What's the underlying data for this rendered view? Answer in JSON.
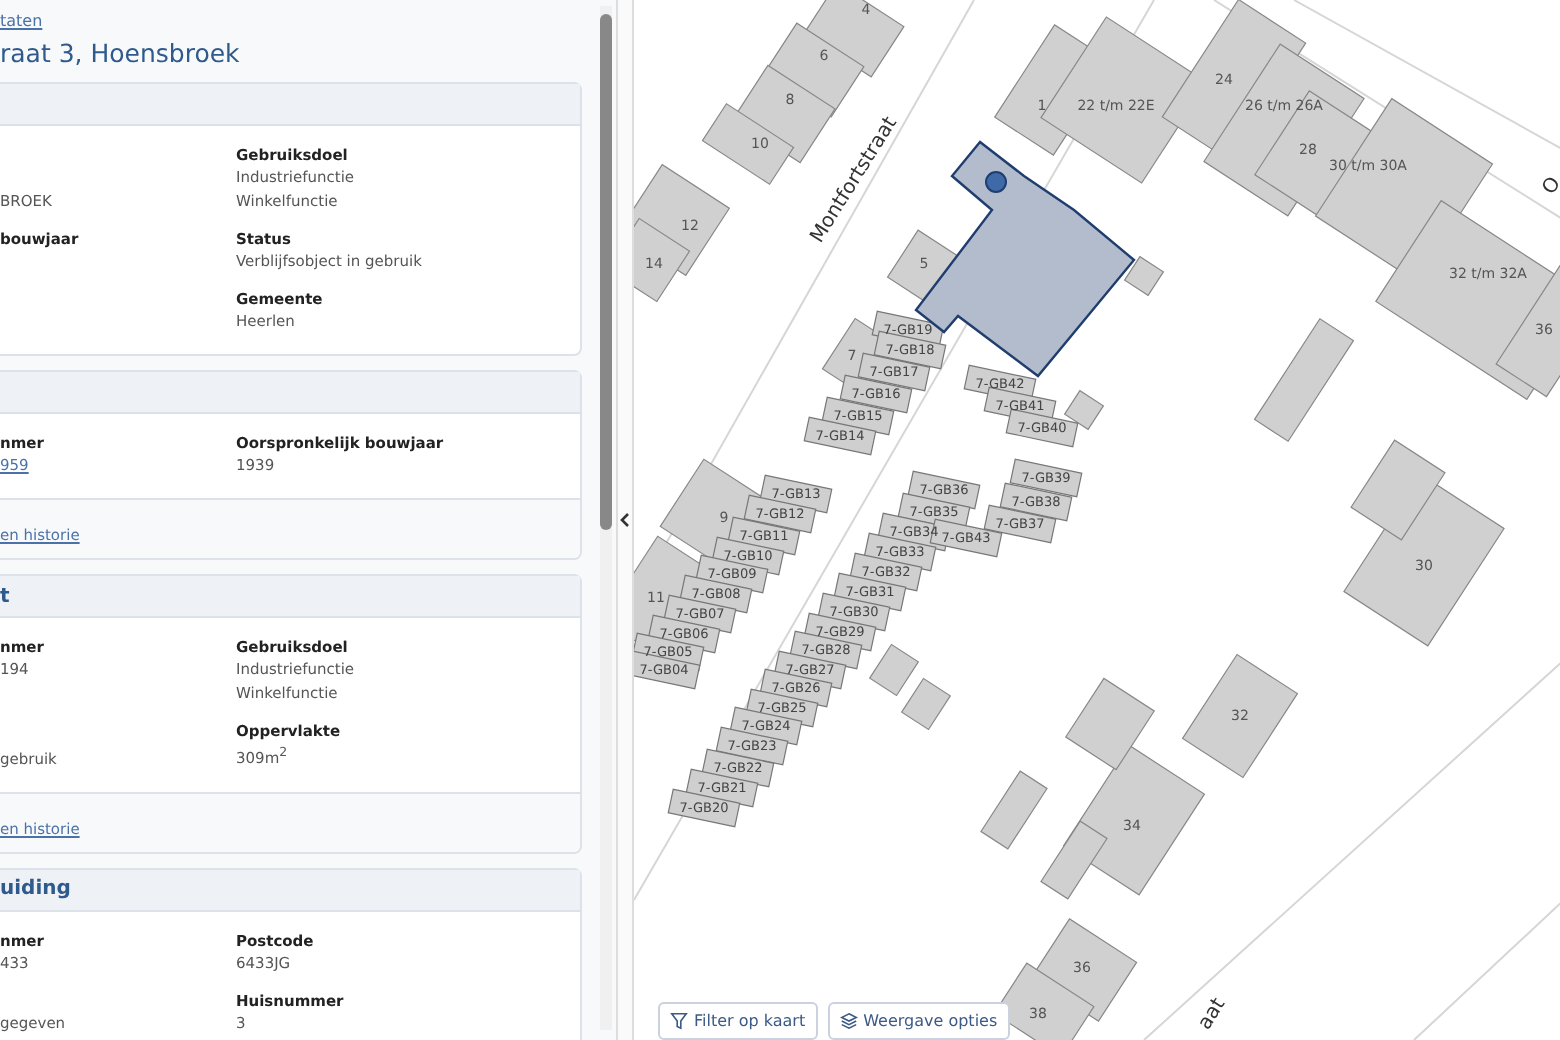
{
  "panel": {
    "breadcrumb": "taten",
    "title": "raat 3, Hoensbroek",
    "cards": [
      {
        "rows": [
          {
            "left": {
              "values": [
                "BROEK"
              ],
              "link": false
            },
            "right": {
              "label": "Gebruiksdoel",
              "values": [
                "Industriefunctie",
                "Winkelfunctie"
              ],
              "link": false
            }
          },
          {
            "left": {
              "label": "bouwjaar"
            },
            "right": {
              "label": "Status",
              "values": [
                "Verblijfsobject in gebruik"
              ],
              "link": false
            }
          },
          {
            "right": {
              "label": "Gemeente",
              "values": [
                "Heerlen"
              ],
              "link": false
            }
          }
        ]
      },
      {
        "rows": [
          {
            "left": {
              "label": "nmer",
              "values": [
                "959"
              ],
              "link": true
            },
            "right": {
              "label": "Oorspronkelijk bouwjaar",
              "values": [
                "1939"
              ],
              "link": false
            }
          }
        ],
        "footer_link": "en historie"
      },
      {
        "header": "t",
        "rows": [
          {
            "left": {
              "label": "nmer",
              "values": [
                "194"
              ],
              "link": false
            },
            "right": {
              "label": "Gebruiksdoel",
              "values": [
                "Industriefunctie",
                "Winkelfunctie"
              ],
              "link": false
            }
          },
          {
            "left": {
              "values": [
                "gebruik"
              ],
              "link": false
            },
            "right": {
              "label": "Oppervlakte",
              "values": [
                "309m$^{2}$"
              ],
              "link": false
            }
          }
        ],
        "footer_link": "en historie"
      },
      {
        "header": "uiding",
        "rows": [
          {
            "left": {
              "label": "nmer",
              "values": [
                "433"
              ],
              "link": false
            },
            "right": {
              "label": "Postcode",
              "values": [
                "6433JG"
              ],
              "link": false
            }
          },
          {
            "left": {
              "values": [
                "gegeven"
              ],
              "link": false
            },
            "right": {
              "label": "Huisnummer",
              "values": [
                "3"
              ],
              "link": false
            }
          }
        ]
      }
    ]
  },
  "map": {
    "labels": [
      {
        "text": "4",
        "kind": "building"
      },
      {
        "text": "6",
        "kind": "building"
      },
      {
        "text": "8",
        "kind": "building"
      },
      {
        "text": "10",
        "kind": "building"
      },
      {
        "text": "12",
        "kind": "building"
      },
      {
        "text": "14",
        "kind": "building"
      },
      {
        "text": "1",
        "kind": "building"
      },
      {
        "text": "22 t/m 22E",
        "kind": "building"
      },
      {
        "text": "24",
        "kind": "building"
      },
      {
        "text": "26 t/m 26A",
        "kind": "building"
      },
      {
        "text": "28",
        "kind": "building"
      },
      {
        "text": "30 t/m 30A",
        "kind": "building"
      },
      {
        "text": "32 t/m 32A",
        "kind": "building"
      },
      {
        "text": "36",
        "kind": "building"
      },
      {
        "text": "Montfortstraat",
        "kind": "street"
      },
      {
        "text": "O",
        "kind": "street"
      },
      {
        "text": "5",
        "kind": "building"
      },
      {
        "text": "7",
        "kind": "building"
      },
      {
        "text": "9",
        "kind": "building"
      },
      {
        "text": "11",
        "kind": "building"
      },
      {
        "text": "30",
        "kind": "building"
      },
      {
        "text": "32",
        "kind": "building"
      },
      {
        "text": "34",
        "kind": "building"
      },
      {
        "text": "36",
        "kind": "building"
      },
      {
        "text": "38",
        "kind": "building"
      },
      {
        "text": "aat",
        "kind": "street"
      },
      {
        "text": "7-GB19",
        "kind": "unit"
      },
      {
        "text": "7-GB18",
        "kind": "unit"
      },
      {
        "text": "7-GB17",
        "kind": "unit"
      },
      {
        "text": "7-GB16",
        "kind": "unit"
      },
      {
        "text": "7-GB15",
        "kind": "unit"
      },
      {
        "text": "7-GB14",
        "kind": "unit"
      },
      {
        "text": "7-GB42",
        "kind": "unit"
      },
      {
        "text": "7-GB41",
        "kind": "unit"
      },
      {
        "text": "7-GB40",
        "kind": "unit"
      },
      {
        "text": "7-GB39",
        "kind": "unit"
      },
      {
        "text": "7-GB38",
        "kind": "unit"
      },
      {
        "text": "7-GB37",
        "kind": "unit"
      },
      {
        "text": "7-GB36",
        "kind": "unit"
      },
      {
        "text": "7-GB35",
        "kind": "unit"
      },
      {
        "text": "7-GB34",
        "kind": "unit"
      },
      {
        "text": "7-GB43",
        "kind": "unit"
      },
      {
        "text": "7-GB33",
        "kind": "unit"
      },
      {
        "text": "7-GB32",
        "kind": "unit"
      },
      {
        "text": "7-GB31",
        "kind": "unit"
      },
      {
        "text": "7-GB30",
        "kind": "unit"
      },
      {
        "text": "7-GB29",
        "kind": "unit"
      },
      {
        "text": "7-GB28",
        "kind": "unit"
      },
      {
        "text": "7-GB27",
        "kind": "unit"
      },
      {
        "text": "7-GB26",
        "kind": "unit"
      },
      {
        "text": "7-GB25",
        "kind": "unit"
      },
      {
        "text": "7-GB24",
        "kind": "unit"
      },
      {
        "text": "7-GB23",
        "kind": "unit"
      },
      {
        "text": "7-GB22",
        "kind": "unit"
      },
      {
        "text": "7-GB21",
        "kind": "unit"
      },
      {
        "text": "7-GB20",
        "kind": "unit"
      },
      {
        "text": "7-GB13",
        "kind": "unit"
      },
      {
        "text": "7-GB12",
        "kind": "unit"
      },
      {
        "text": "7-GB11",
        "kind": "unit"
      },
      {
        "text": "7-GB10",
        "kind": "unit"
      },
      {
        "text": "7-GB09",
        "kind": "unit"
      },
      {
        "text": "7-GB08",
        "kind": "unit"
      },
      {
        "text": "7-GB07",
        "kind": "unit"
      },
      {
        "text": "7-GB06",
        "kind": "unit"
      },
      {
        "text": "7-GB05",
        "kind": "unit"
      },
      {
        "text": "7-GB04",
        "kind": "unit"
      }
    ],
    "buttons": [
      {
        "label": "Filter op kaart",
        "kind": "filter"
      },
      {
        "label": "Weergave opties",
        "kind": "layers"
      }
    ]
  }
}
